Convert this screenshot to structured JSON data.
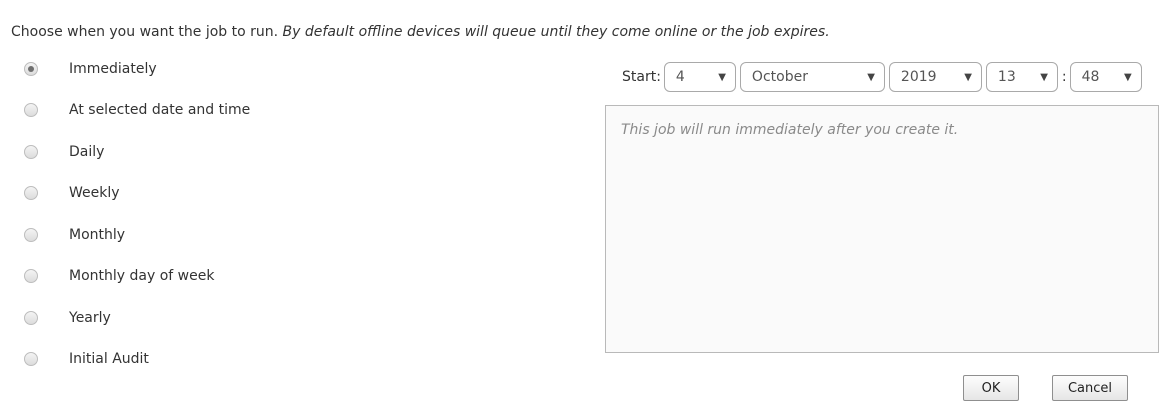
{
  "intro": {
    "text": "Choose when you want the job to run. ",
    "italic_text": "By default offline devices will queue until they come online or the job expires."
  },
  "schedule_options": [
    {
      "label": "Immediately",
      "checked": true
    },
    {
      "label": "At selected date and time",
      "checked": false
    },
    {
      "label": "Daily",
      "checked": false
    },
    {
      "label": "Weekly",
      "checked": false
    },
    {
      "label": "Monthly",
      "checked": false
    },
    {
      "label": "Monthly day of week",
      "checked": false
    },
    {
      "label": "Yearly",
      "checked": false
    },
    {
      "label": "Initial Audit",
      "checked": false
    }
  ],
  "start": {
    "label": "Start:",
    "day": "4",
    "month": "October",
    "year": "2019",
    "hour": "13",
    "separator": ":",
    "minute": "48",
    "dropdown_arrow": "▼"
  },
  "description": "This job will run immediately after you create it.",
  "buttons": {
    "ok": "OK",
    "cancel": "Cancel"
  }
}
